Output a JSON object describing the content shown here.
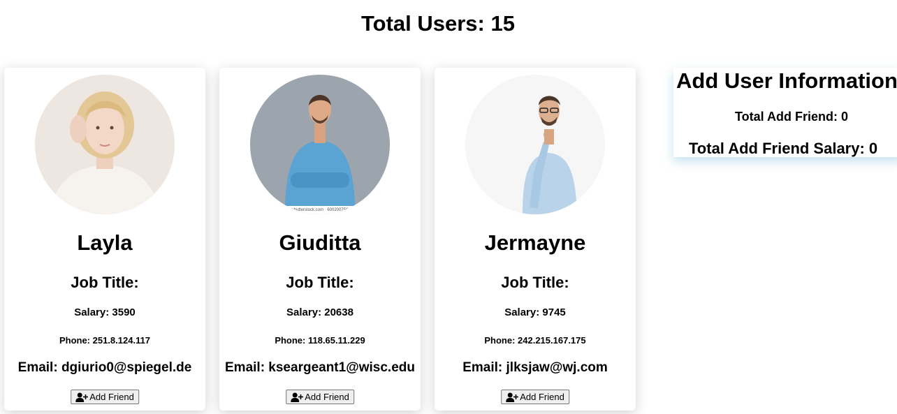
{
  "header": {
    "total_users_label": "Total Users: 15"
  },
  "users": [
    {
      "name": "Layla",
      "job_title": "Job Title:",
      "salary": "Salary: 3590",
      "phone": "Phone: 251.8.124.117",
      "email": "Email: dgiurio0@spiegel.de",
      "add_button_label": "Add Friend",
      "avatar_icon": "person-photo-avatar"
    },
    {
      "name": "Giuditta",
      "job_title": "Job Title:",
      "salary": "Salary: 20638",
      "phone": "Phone: 118.65.11.229",
      "email": "Email: kseargeant1@wisc.edu",
      "add_button_label": "Add Friend",
      "avatar_icon": "person-photo-avatar",
      "photo_watermark": "shutterstock.com · 600200750"
    },
    {
      "name": "Jermayne",
      "job_title": "Job Title:",
      "salary": "Salary: 9745",
      "phone": "Phone: 242.215.167.175",
      "email": "Email: jlksjaw@wj.com",
      "add_button_label": "Add Friend",
      "avatar_icon": "person-photo-avatar"
    }
  ],
  "info_panel": {
    "title": "Add User Information",
    "total_add_friend": "Total Add Friend: 0",
    "total_add_friend_salary": "Total Add Friend Salary: 0"
  },
  "icons": {
    "add_friend_icon": "user-plus-icon"
  }
}
